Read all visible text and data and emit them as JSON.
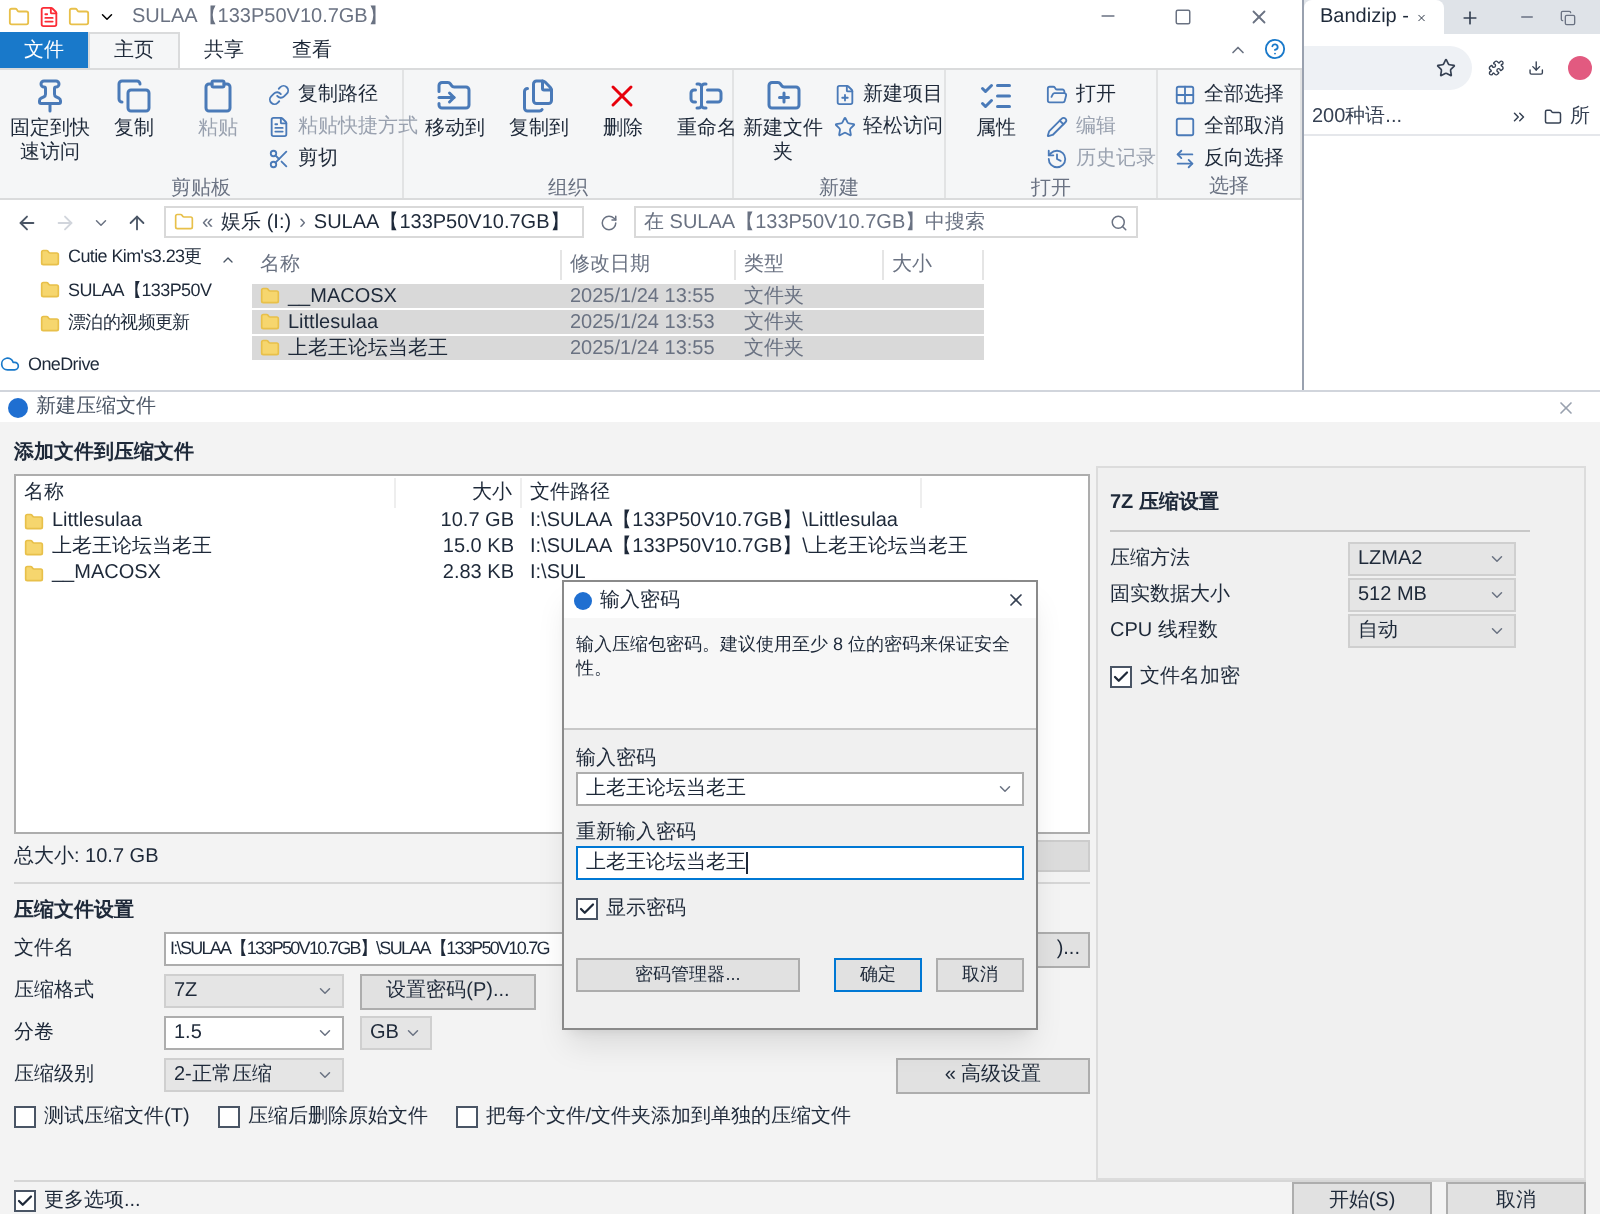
{
  "explorer": {
    "title": "SULAA【133P50V10.7GB】",
    "tabs": [
      {
        "label": "文件",
        "kind": "file",
        "selected": false
      },
      {
        "label": "主页",
        "kind": "tab",
        "selected": true
      },
      {
        "label": "共享",
        "kind": "tab",
        "selected": false
      },
      {
        "label": "查看",
        "kind": "tab",
        "selected": false
      }
    ],
    "ribbon_groups": [
      {
        "name": "剪贴板",
        "items": [
          {
            "label": "固定到快速访问",
            "kind": "large",
            "disabled": false
          },
          {
            "label": "复制",
            "kind": "large",
            "disabled": false
          },
          {
            "label": "粘贴",
            "kind": "large",
            "disabled": true
          },
          {
            "label": "复制路径",
            "kind": "small",
            "disabled": false
          },
          {
            "label": "粘贴快捷方式",
            "kind": "small",
            "disabled": true
          },
          {
            "label": "剪切",
            "kind": "small",
            "disabled": false
          }
        ]
      },
      {
        "name": "组织",
        "items": [
          {
            "label": "移动到",
            "kind": "large",
            "disabled": false
          },
          {
            "label": "复制到",
            "kind": "large",
            "disabled": false
          },
          {
            "label": "删除",
            "kind": "large",
            "disabled": false
          },
          {
            "label": "重命名",
            "kind": "large",
            "disabled": false
          }
        ]
      },
      {
        "name": "新建",
        "items": [
          {
            "label": "新建文件夹",
            "kind": "large",
            "disabled": false
          },
          {
            "label": "新建项目",
            "kind": "small",
            "disabled": false
          },
          {
            "label": "轻松访问",
            "kind": "small",
            "disabled": false
          }
        ]
      },
      {
        "name": "打开",
        "items": [
          {
            "label": "属性",
            "kind": "large",
            "disabled": false
          },
          {
            "label": "打开",
            "kind": "small",
            "disabled": false
          },
          {
            "label": "编辑",
            "kind": "small",
            "disabled": true
          },
          {
            "label": "历史记录",
            "kind": "small",
            "disabled": true
          }
        ]
      },
      {
        "name": "选择",
        "items": [
          {
            "label": "全部选择",
            "kind": "small",
            "disabled": false
          },
          {
            "label": "全部取消",
            "kind": "small",
            "disabled": false
          },
          {
            "label": "反向选择",
            "kind": "small",
            "disabled": false
          }
        ]
      }
    ],
    "address": {
      "prefix": "«",
      "separator": "›",
      "segments": [
        "娱乐 (I:)",
        "SULAA【133P50V10.7GB】"
      ]
    },
    "search": {
      "placeholder": "在 SULAA【133P50V10.7GB】中搜索"
    },
    "nav_items": [
      {
        "label": "Cutie Kim's3.23更",
        "kind": "folder"
      },
      {
        "label": "SULAA【133P50V",
        "kind": "folder"
      },
      {
        "label": "漂泊的视频更新",
        "kind": "folder"
      },
      {
        "label": "OneDrive",
        "kind": "cloud"
      }
    ],
    "columns": [
      "名称",
      "修改日期",
      "类型",
      "大小"
    ],
    "rows": [
      {
        "name": "__MACOSX",
        "date": "2025/1/24 13:55",
        "type": "文件夹",
        "selected": true
      },
      {
        "name": "Littlesulaa",
        "date": "2025/1/24 13:53",
        "type": "文件夹",
        "selected": true
      },
      {
        "name": "上老王论坛当老王",
        "date": "2025/1/24 13:55",
        "type": "文件夹",
        "selected": true
      }
    ]
  },
  "browser": {
    "tab_title": "Bandizip - ",
    "bookmarks": [
      "200种语...",
      "所"
    ]
  },
  "bandizip": {
    "title": "新建压缩文件",
    "add_heading": "添加文件到压缩文件",
    "columns": [
      "名称",
      "大小",
      "文件路径"
    ],
    "files": [
      {
        "name": "Littlesulaa",
        "size": "10.7 GB",
        "path": "I:\\SULAA【133P50V10.7GB】\\Littlesulaa"
      },
      {
        "name": "上老王论坛当老王",
        "size": "15.0 KB",
        "path": "I:\\SULAA【133P50V10.7GB】\\上老王论坛当老王"
      },
      {
        "name": "__MACOSX",
        "size": "2.83 KB",
        "path": "I:\\SUL"
      }
    ],
    "total": "总大小: 10.7 GB",
    "settings_heading": "压缩文件设置",
    "filename": {
      "label": "文件名",
      "value": "I:\\SULAA【133P50V10.7GB】\\SULAA【133P50V10.7G",
      "button": ")..."
    },
    "format": {
      "label": "压缩格式",
      "value": "7Z",
      "button": "设置密码(P)..."
    },
    "split": {
      "label": "分卷",
      "value": "1.5",
      "unit": "GB"
    },
    "level": {
      "label": "压缩级别",
      "value": "2-正常压缩",
      "button": "« 高级设置"
    },
    "options": [
      {
        "label": "测试压缩文件(T)",
        "checked": false
      },
      {
        "label": "压缩后删除原始文件",
        "checked": false
      },
      {
        "label": "把每个文件/文件夹添加到单独的压缩文件",
        "checked": false
      }
    ],
    "more_options": {
      "label": "更多选项...",
      "checked": true
    },
    "buttons": [
      "开始(S)",
      "取消"
    ],
    "panel": {
      "heading": "7Z 压缩设置",
      "settings": [
        {
          "label": "压缩方法",
          "value": "LZMA2"
        },
        {
          "label": "固实数据大小",
          "value": "512 MB"
        },
        {
          "label": "CPU 线程数",
          "value": "自动"
        }
      ],
      "encrypt_names": {
        "label": "文件名加密",
        "checked": true
      }
    }
  },
  "password_dialog": {
    "title": "输入密码",
    "message": "输入压缩包密码。建议使用至少 8 位的密码来保证安全性。",
    "password_label": "输入密码",
    "password": "上老王论坛当老王",
    "confirm_label": "重新输入密码",
    "confirm": "上老王论坛当老王",
    "show_password": {
      "label": "显示密码",
      "checked": true
    },
    "buttons": [
      {
        "label": "密码管理器...",
        "default": false,
        "kind": "wide"
      },
      {
        "label": "确定",
        "default": true,
        "kind": "normal"
      },
      {
        "label": "取消",
        "default": false,
        "kind": "normal"
      }
    ]
  }
}
